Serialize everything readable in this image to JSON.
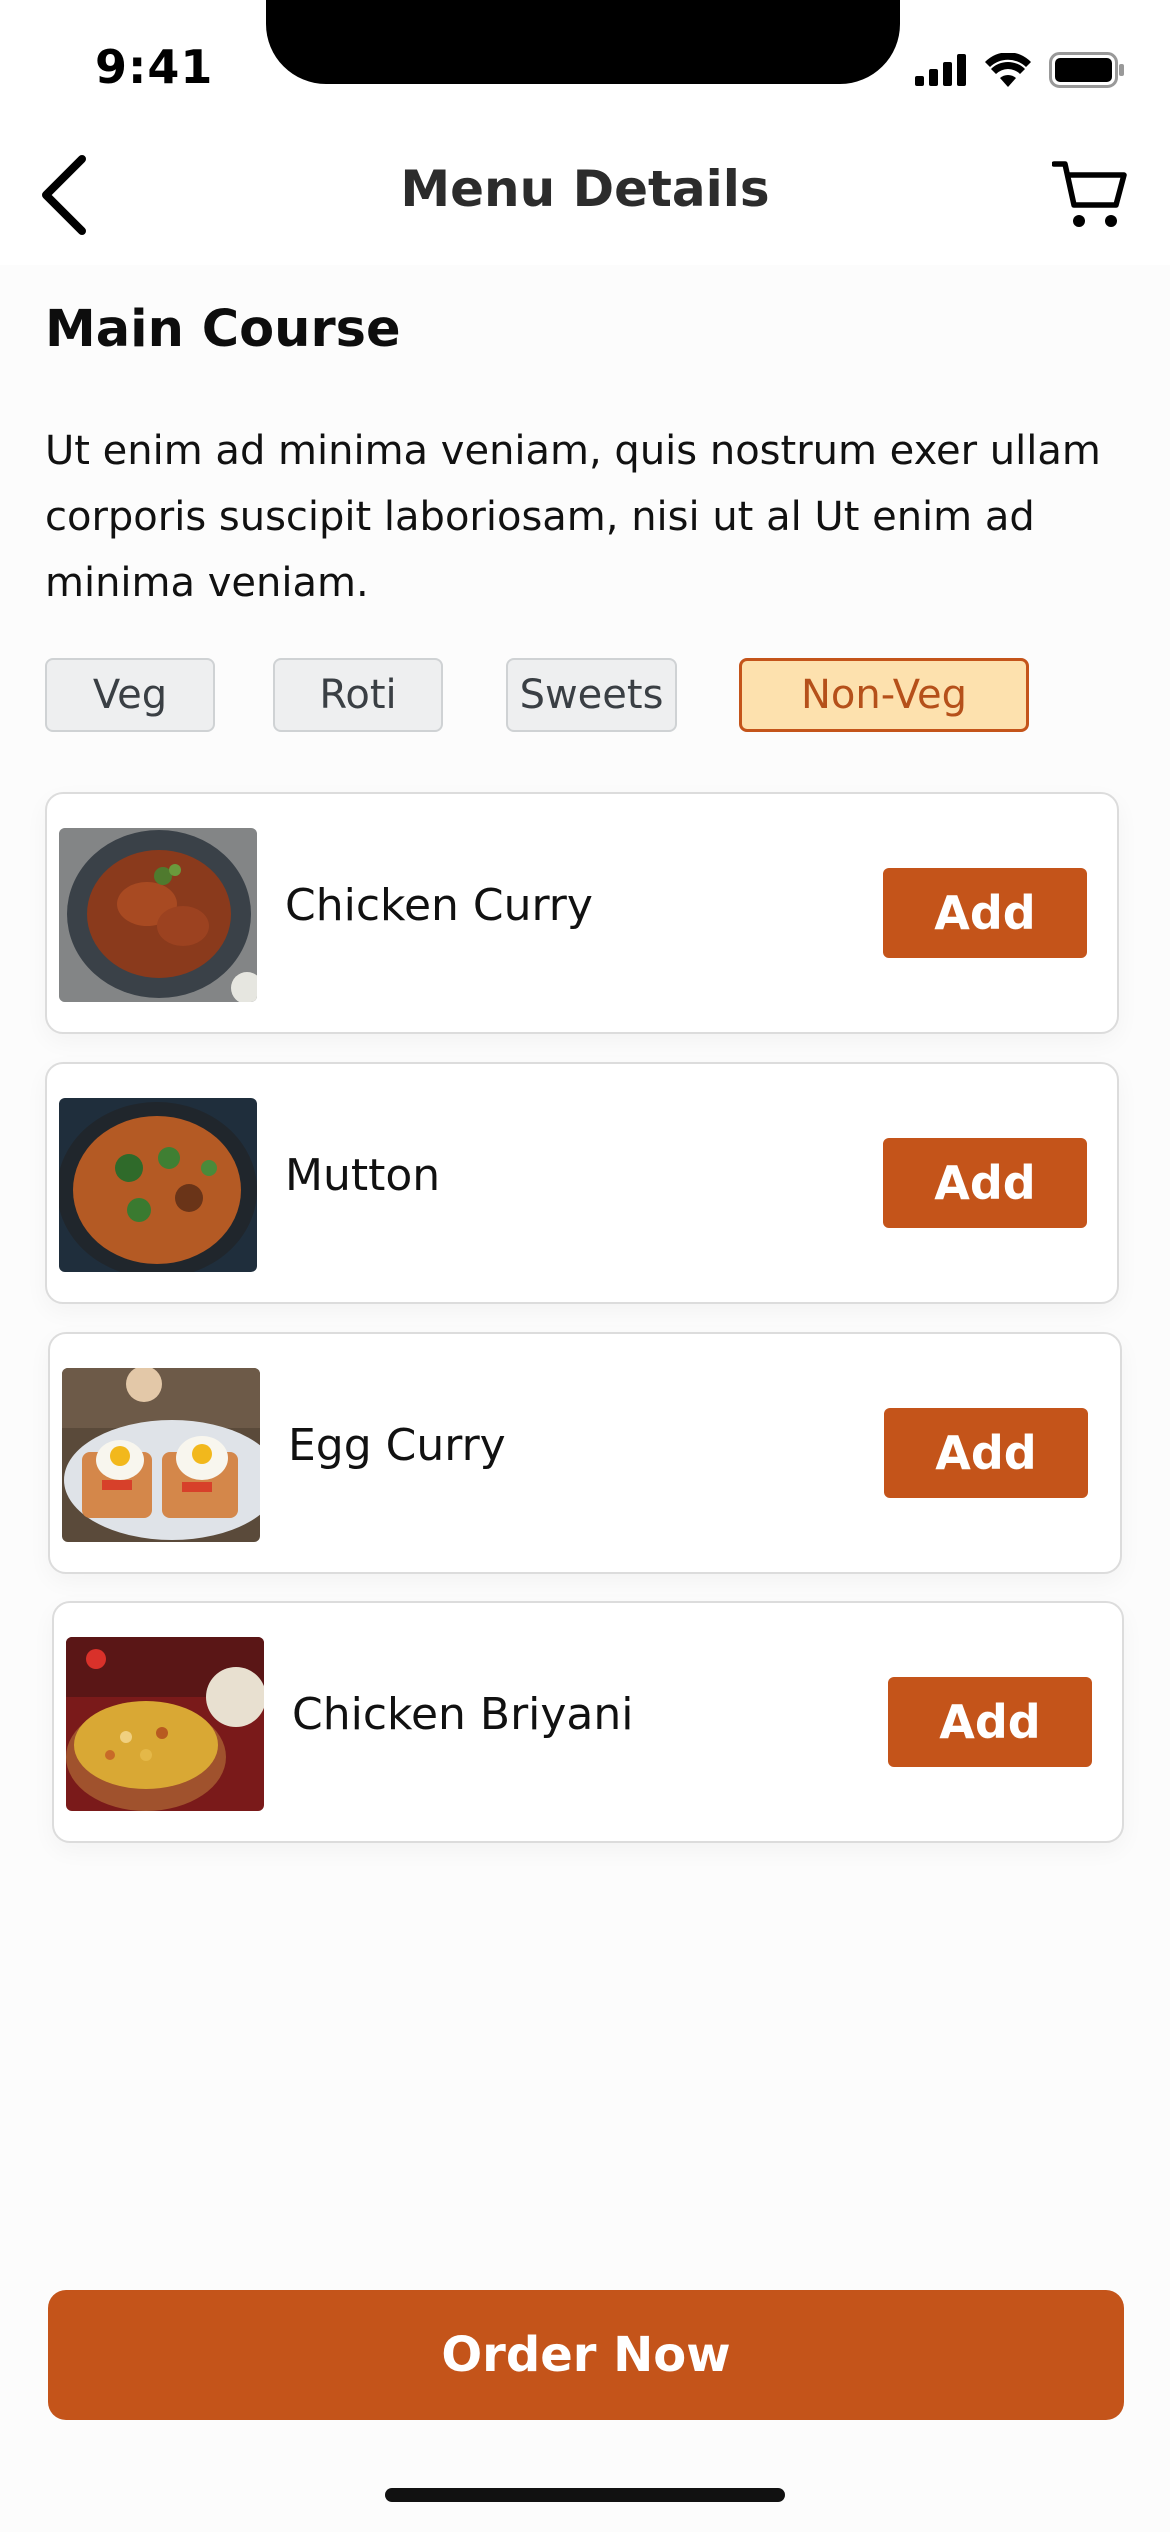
{
  "status_bar": {
    "time": "9:41"
  },
  "header": {
    "title": "Menu Details"
  },
  "section": {
    "title": "Main Course",
    "description": "Ut enim ad minima veniam, quis nostrum exer ullam corporis suscipit laboriosam, nisi ut al Ut enim ad minima veniam."
  },
  "filters": [
    {
      "label": "Veg",
      "active": false
    },
    {
      "label": "Roti",
      "active": false
    },
    {
      "label": "Sweets",
      "active": false
    },
    {
      "label": "Non-Veg",
      "active": true
    }
  ],
  "menu_items": [
    {
      "name": "Chicken Curry",
      "add_label": "Add"
    },
    {
      "name": "Mutton",
      "add_label": "Add"
    },
    {
      "name": "Egg Curry",
      "add_label": "Add"
    },
    {
      "name": "Chicken Briyani",
      "add_label": "Add"
    }
  ],
  "order_button": {
    "label": "Order Now"
  },
  "colors": {
    "accent": "#c4541a",
    "chip_active_bg": "#fde1ae",
    "chip_bg": "#eeeff0"
  },
  "icons": {
    "back": "chevron-left-icon",
    "cart": "cart-icon",
    "signal": "signal-icon",
    "wifi": "wifi-icon",
    "battery": "battery-icon"
  }
}
